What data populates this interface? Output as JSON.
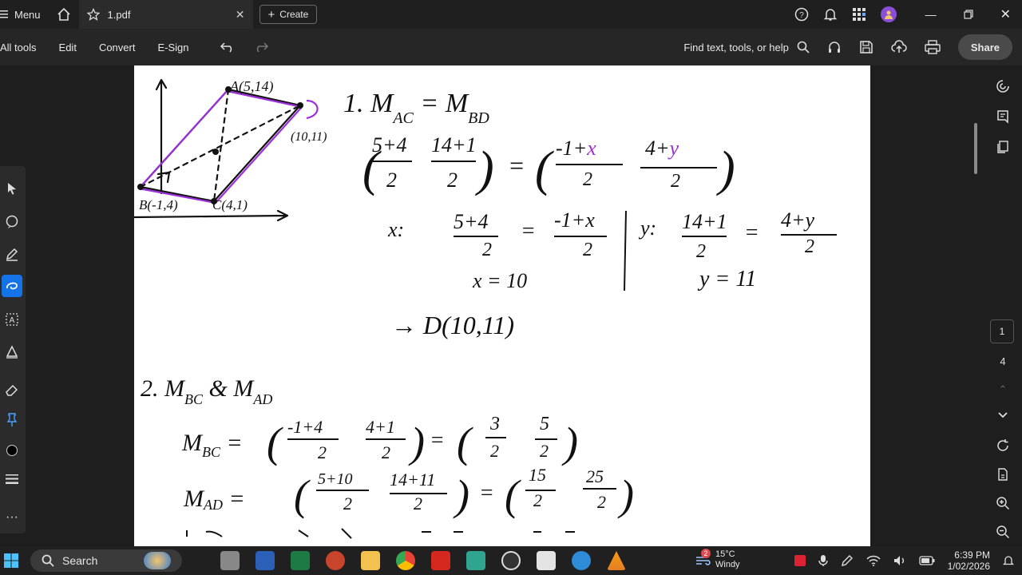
{
  "topbar": {
    "menu_label": "Menu",
    "tab_title": "1.pdf",
    "create_label": "Create"
  },
  "toolbar": {
    "all_tools": "All tools",
    "edit": "Edit",
    "convert": "Convert",
    "esign": "E-Sign",
    "find": "Find text, tools, or help",
    "share": "Share"
  },
  "rightrail": {
    "current_page": "1",
    "total_pages": "4"
  },
  "taskbar": {
    "search_label": "Search",
    "weather_temp": "15°C",
    "weather_cond": "Windy",
    "time": "6:39 PM",
    "date": "1/02/2026",
    "notif_count": "2"
  },
  "document": {
    "labels": {
      "pointA": "A(5,14)",
      "pointB": "B(-1,4)",
      "pointC": "C(4,1)",
      "pointD": "D",
      "pointD_coord": "(10,11)"
    },
    "line1": "1. M_AC = M_BD",
    "eq1_left_num1": "5+4",
    "eq1_left_den1": "2",
    "eq1_left_num2": "14+1",
    "eq1_left_den2": "2",
    "eq1_right_num1": "-1+",
    "eq1_var_x": "x",
    "eq1_right_den1": "2",
    "eq1_right_num2": "4+",
    "eq1_var_y": "y",
    "eq1_right_den2": "2",
    "x_label": "x:",
    "x_eq_num_l": "5+4",
    "x_eq_num_r": "-1+x",
    "x_eq_den": "2",
    "x_result": "x = 10",
    "y_label": "y:",
    "y_eq_num_l": "14+1",
    "y_eq_num_r": "4+y",
    "y_eq_den": "2",
    "y_result": "y = 11",
    "d_result": "→ D(10,11)",
    "line2": "2. M_BC & M_AD",
    "mbc_label": "M_BC =",
    "mbc_n1": "-1+4",
    "mbc_n2": "4+1",
    "mbc_r1": "3",
    "mbc_r2": "5",
    "mad_label": "M_AD =",
    "mad_n1": "5+10",
    "mad_n2": "14+11",
    "mad_r1": "15",
    "mad_r2": "25",
    "den": "2"
  }
}
